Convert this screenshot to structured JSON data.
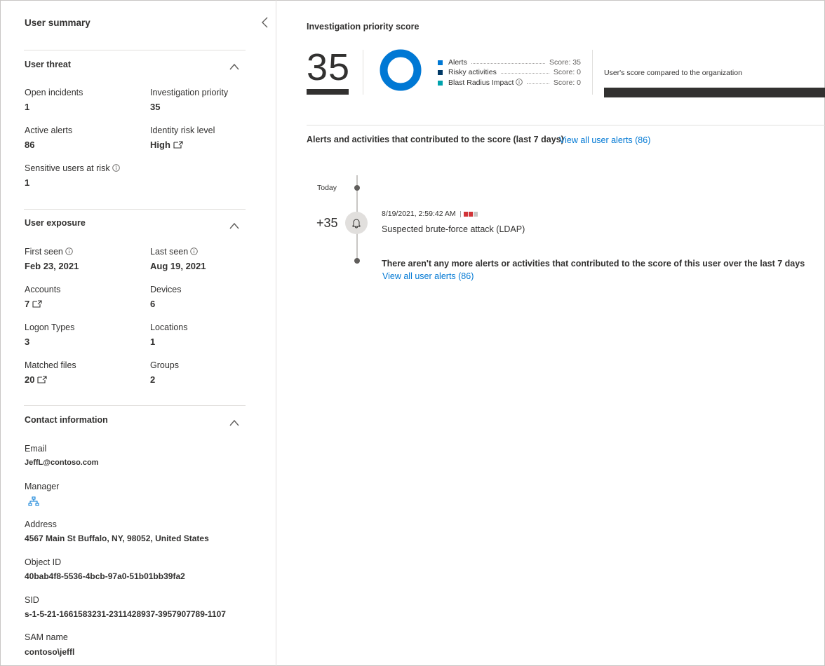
{
  "summary": {
    "title": "User summary",
    "collapse_icon": "chevron-left-icon"
  },
  "user_threat": {
    "title": "User threat",
    "fields": {
      "open_incidents": {
        "label": "Open incidents",
        "value": "1"
      },
      "investigation_priority": {
        "label": "Investigation priority",
        "value": "35"
      },
      "active_alerts": {
        "label": "Active alerts",
        "value": "86"
      },
      "identity_risk_level": {
        "label": "Identity risk level",
        "value": "High"
      },
      "sensitive_users": {
        "label": "Sensitive users at risk",
        "value": "1"
      }
    }
  },
  "user_exposure": {
    "title": "User exposure",
    "fields": {
      "first_seen": {
        "label": "First seen",
        "value": "Feb 23, 2021"
      },
      "last_seen": {
        "label": "Last seen",
        "value": "Aug 19, 2021"
      },
      "accounts": {
        "label": "Accounts",
        "value": "7"
      },
      "devices": {
        "label": "Devices",
        "value": "6"
      },
      "logon_types": {
        "label": "Logon Types",
        "value": "3"
      },
      "locations": {
        "label": "Locations",
        "value": "1"
      },
      "matched_files": {
        "label": "Matched files",
        "value": "20"
      },
      "groups": {
        "label": "Groups",
        "value": "2"
      }
    }
  },
  "contact": {
    "title": "Contact information",
    "fields": {
      "email": {
        "label": "Email",
        "value": "JeffL@contoso.com"
      },
      "manager": {
        "label": "Manager",
        "icon": "org-chart-icon"
      },
      "address": {
        "label": "Address",
        "value": "4567 Main St Buffalo, NY, 98052, United States"
      },
      "object_id": {
        "label": "Object ID",
        "value": "40bab4f8-5536-4bcb-97a0-51b01bb39fa2"
      },
      "sid": {
        "label": "SID",
        "value": "s-1-5-21-1661583231-2311428937-3957907789-1107"
      },
      "sam_name": {
        "label": "SAM name",
        "value": "contoso\\jeffl"
      }
    }
  },
  "score": {
    "title": "Investigation priority score",
    "value": "35",
    "breakdown": [
      {
        "name": "Alerts",
        "score": "Score: 35",
        "color": "#0078d4",
        "fraction": 1.0
      },
      {
        "name": "Risky activities",
        "score": "Score: 0",
        "color": "#003966",
        "fraction": 0.0
      },
      {
        "name": "Blast Radius Impact",
        "score": "Score: 0",
        "color": "#00a2ad",
        "fraction": 0.0
      }
    ],
    "comparison_label": "User's score compared to the organization"
  },
  "contributions": {
    "title": "Alerts and activities that contributed to the score (last 7 days)",
    "view_all_link": "View all user alerts (86)",
    "today_label": "Today",
    "items": [
      {
        "delta": "+35",
        "time": "8/19/2021, 2:59:42 AM",
        "name": "Suspected brute-force attack (LDAP)",
        "icon": "bell-icon",
        "severity_filled": 2,
        "severity_total": 3
      }
    ],
    "end_message": "There aren't any more alerts or activities that contributed to the score of this user over the last 7 days",
    "end_link": "View all user alerts (86)"
  },
  "colors": {
    "accent": "#0078d4",
    "severity_high": "#d13438"
  }
}
